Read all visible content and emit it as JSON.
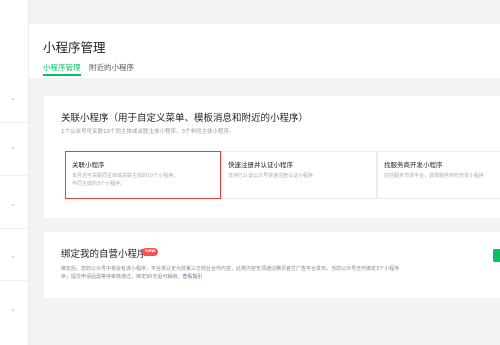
{
  "page": {
    "title": "小程序管理",
    "tabs": [
      {
        "label": "小程序管理",
        "active": true
      },
      {
        "label": "附近的小程序",
        "active": false
      }
    ]
  },
  "link_card": {
    "title": "关联小程序（用于自定义菜单、模板消息和附近的小程序）",
    "subtitle": "1个公众号可关联10个同主体或关联主体小程序，3个非同主体小程序。",
    "options": [
      {
        "title": "关联小程序",
        "desc_line1": "本月还可关联同主体或关联主体的10个小程序，",
        "desc_line2": "不同主体的3个小程序。"
      },
      {
        "title": "快速注册并认证小程序",
        "desc_line1": "支持已认证公众号快速注册认证小程序",
        "desc_line2": ""
      },
      {
        "title": "找服务商开发小程序",
        "desc_line1": "前往服务市场平台，选择服务商代开发小程序",
        "desc_line2": ""
      }
    ]
  },
  "bind_card": {
    "title": "绑定我的自营小程序",
    "badge": "new",
    "desc_line1": "绑定后，您的公众号中将会有该小程序，平台将认定为非第三方商业合作内容，此类内容无须通过腾讯官方广告平台发布。当前公众号还可绑定3个小程序",
    "desc_line2": "序，提交申请后需等待审核通过。绑定90天后可解绑。",
    "doc_link": "查看指引"
  },
  "colors": {
    "accent": "#07c160",
    "highlight_border": "#e0433a",
    "badge": "#fa5151",
    "link": "#576b95"
  }
}
